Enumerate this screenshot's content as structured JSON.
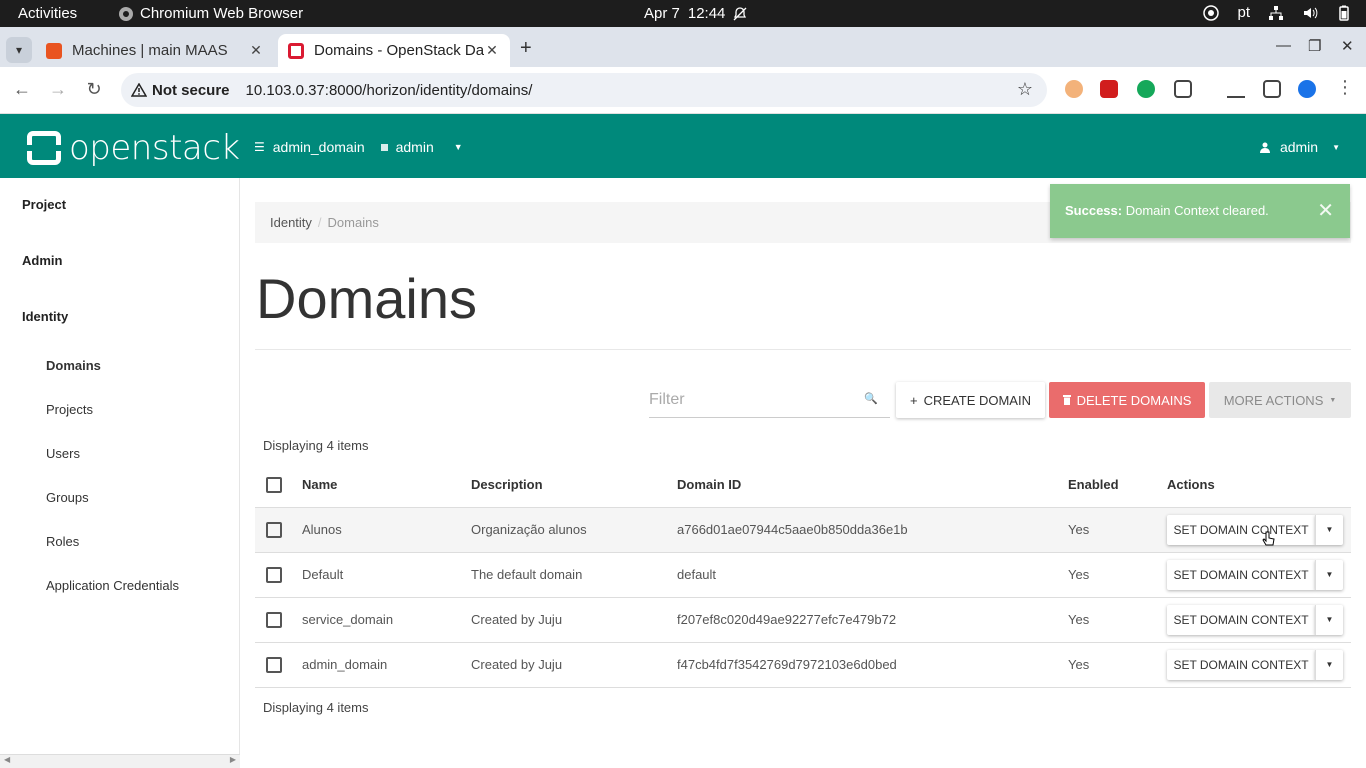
{
  "system": {
    "activities": "Activities",
    "app_name": "Chromium Web Browser",
    "date": "Apr 7",
    "time": "12:44",
    "keyboard_layout": "pt"
  },
  "browser": {
    "tabs": [
      {
        "title": "Machines | main MAAS",
        "active": false,
        "favicon_color": "#e95420"
      },
      {
        "title": "Domains - OpenStack Da",
        "active": true,
        "favicon_color": "#da1a32"
      }
    ],
    "security_label": "Not secure",
    "url": "10.103.0.37:8000/horizon/identity/domains/"
  },
  "header": {
    "logo_text": "openstack",
    "domain_context": "admin_domain",
    "project_context": "admin",
    "user": "admin",
    "brand_color": "#00897b"
  },
  "sidebar": {
    "sections": [
      {
        "label": "Project"
      },
      {
        "label": "Admin"
      },
      {
        "label": "Identity"
      }
    ],
    "items": [
      {
        "label": "Domains",
        "active": true
      },
      {
        "label": "Projects"
      },
      {
        "label": "Users"
      },
      {
        "label": "Groups"
      },
      {
        "label": "Roles"
      },
      {
        "label": "Application Credentials"
      }
    ]
  },
  "breadcrumb": {
    "parent": "Identity",
    "current": "Domains"
  },
  "page": {
    "title": "Domains",
    "filter_placeholder": "Filter",
    "create_label": "CREATE DOMAIN",
    "delete_label": "DELETE DOMAINS",
    "more_label": "MORE ACTIONS",
    "displaying_top": "Displaying 4 items",
    "displaying_bottom": "Displaying 4 items"
  },
  "table": {
    "headers": [
      "Name",
      "Description",
      "Domain ID",
      "Enabled",
      "Actions"
    ],
    "rows": [
      {
        "name": "Alunos",
        "description": "Organização alunos",
        "domain_id": "a766d01ae07944c5aae0b850dda36e1b",
        "enabled": "Yes",
        "action": "SET DOMAIN CONTEXT"
      },
      {
        "name": "Default",
        "description": "The default domain",
        "domain_id": "default",
        "enabled": "Yes",
        "action": "SET DOMAIN CONTEXT"
      },
      {
        "name": "service_domain",
        "description": "Created by Juju",
        "domain_id": "f207ef8c020d49ae92277efc7e479b72",
        "enabled": "Yes",
        "action": "SET DOMAIN CONTEXT"
      },
      {
        "name": "admin_domain",
        "description": "Created by Juju",
        "domain_id": "f47cb4fd7f3542769d7972103e6d0bed",
        "enabled": "Yes",
        "action": "SET DOMAIN CONTEXT"
      }
    ]
  },
  "toast": {
    "strong": "Success:",
    "message": "Domain Context cleared.",
    "color": "#8bc98e"
  }
}
